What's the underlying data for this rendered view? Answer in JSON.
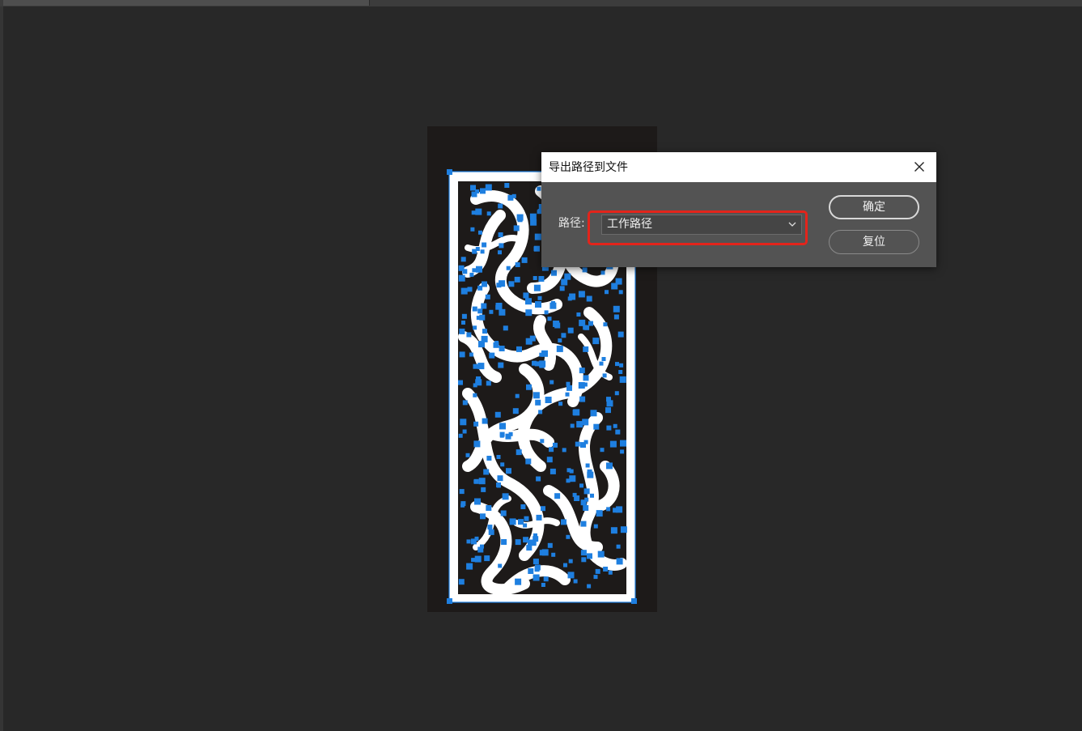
{
  "dialog": {
    "title": "导出路径到文件",
    "path_label": "路径:",
    "path_value": "工作路径",
    "ok_label": "确定",
    "reset_label": "复位"
  },
  "colors": {
    "workspace_bg": "#282828",
    "dialog_bg": "#535353",
    "highlight": "#e3241b",
    "anchor_points": "#1e7fe0"
  },
  "icons": {
    "close": "close-icon",
    "dropdown": "chevron-down-icon"
  }
}
